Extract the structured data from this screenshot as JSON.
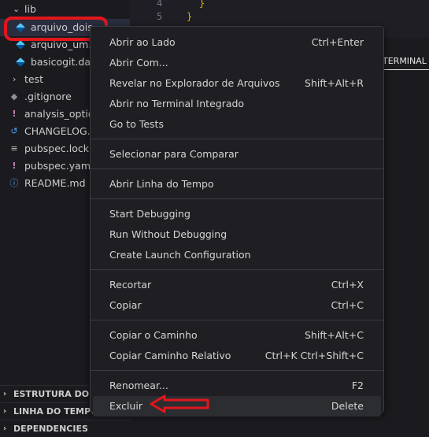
{
  "explorer": {
    "folders": {
      "lib": "lib",
      "test": "test"
    },
    "files": [
      {
        "label": "arquivo_dois",
        "icon": "dart-icon"
      },
      {
        "label": "arquivo_um.d",
        "icon": "dart-icon"
      },
      {
        "label": "basicogit.dar",
        "icon": "dart-icon"
      }
    ],
    "root_files": [
      {
        "label": ".gitignore",
        "icon": "git-icon",
        "glyph": "◆"
      },
      {
        "label": "analysis_optio",
        "icon": "yaml-icon",
        "glyph": "!"
      },
      {
        "label": "CHANGELOG.m",
        "icon": "changelog-icon",
        "glyph": "↺"
      },
      {
        "label": "pubspec.lock",
        "icon": "lock-icon",
        "glyph": "≡"
      },
      {
        "label": "pubspec.yaml",
        "icon": "yaml-icon",
        "glyph": "!"
      },
      {
        "label": "README.md",
        "icon": "info-icon",
        "glyph": "ⓘ"
      }
    ],
    "sections": [
      {
        "label": "ESTRUTURA DO CÓ"
      },
      {
        "label": "LINHA DO TEMPO"
      },
      {
        "label": "DEPENDENCIES"
      }
    ]
  },
  "editor": {
    "line_numbers": [
      "4",
      "5"
    ],
    "lines": [
      "}",
      "}"
    ]
  },
  "panel": {
    "tab_label": "TERMINAL"
  },
  "context_menu": {
    "groups": [
      [
        {
          "label": "Abrir ao Lado",
          "shortcut": "Ctrl+Enter"
        },
        {
          "label": "Abrir Com...",
          "shortcut": ""
        },
        {
          "label": "Revelar no Explorador de Arquivos",
          "shortcut": "Shift+Alt+R"
        },
        {
          "label": "Abrir no Terminal Integrado",
          "shortcut": ""
        },
        {
          "label": "Go to Tests",
          "shortcut": ""
        }
      ],
      [
        {
          "label": "Selecionar para Comparar",
          "shortcut": ""
        }
      ],
      [
        {
          "label": "Abrir Linha do Tempo",
          "shortcut": ""
        }
      ],
      [
        {
          "label": "Start Debugging",
          "shortcut": ""
        },
        {
          "label": "Run Without Debugging",
          "shortcut": ""
        },
        {
          "label": "Create Launch Configuration",
          "shortcut": ""
        }
      ],
      [
        {
          "label": "Recortar",
          "shortcut": "Ctrl+X"
        },
        {
          "label": "Copiar",
          "shortcut": "Ctrl+C"
        }
      ],
      [
        {
          "label": "Copiar o Caminho",
          "shortcut": "Shift+Alt+C"
        },
        {
          "label": "Copiar Caminho Relativo",
          "shortcut": "Ctrl+K Ctrl+Shift+C"
        }
      ],
      [
        {
          "label": "Renomear...",
          "shortcut": "F2"
        },
        {
          "label": "Excluir",
          "shortcut": "Delete",
          "active": true
        }
      ]
    ]
  },
  "annotations": {
    "highlight_color": "#e3161c"
  },
  "colors": {
    "menu_bg": "#1f1f23",
    "sidebar_bg": "#1b1b1f",
    "brace": "#d7ba00"
  }
}
